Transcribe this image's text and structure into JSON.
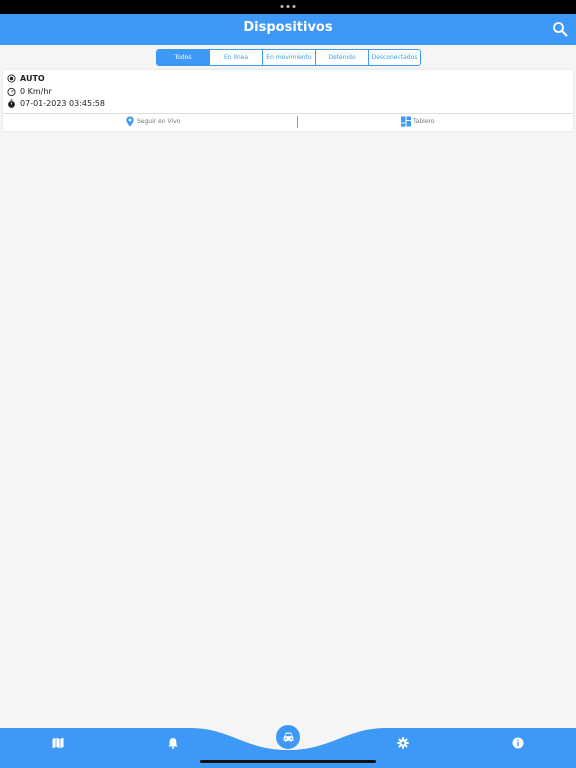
{
  "header": {
    "title": "Dispositivos"
  },
  "filters": {
    "tabs": [
      {
        "label": "Todos"
      },
      {
        "label": "En línea"
      },
      {
        "label": "En movimiento"
      },
      {
        "label": "Detenido"
      },
      {
        "label": "Desconectados"
      }
    ]
  },
  "device": {
    "name": "AUTO",
    "speed": "0 Km/hr",
    "timestamp": "07-01-2023 03:45:58",
    "follow_label": "Seguir en Vivo",
    "dashboard_label": "Tablero"
  },
  "colors": {
    "accent": "#3d99f5",
    "background": "#f5f5f5"
  },
  "bottom_nav": {
    "items": [
      "map-icon",
      "bell-icon",
      "car-icon",
      "gear-icon",
      "info-icon"
    ],
    "selected": "car-icon"
  }
}
